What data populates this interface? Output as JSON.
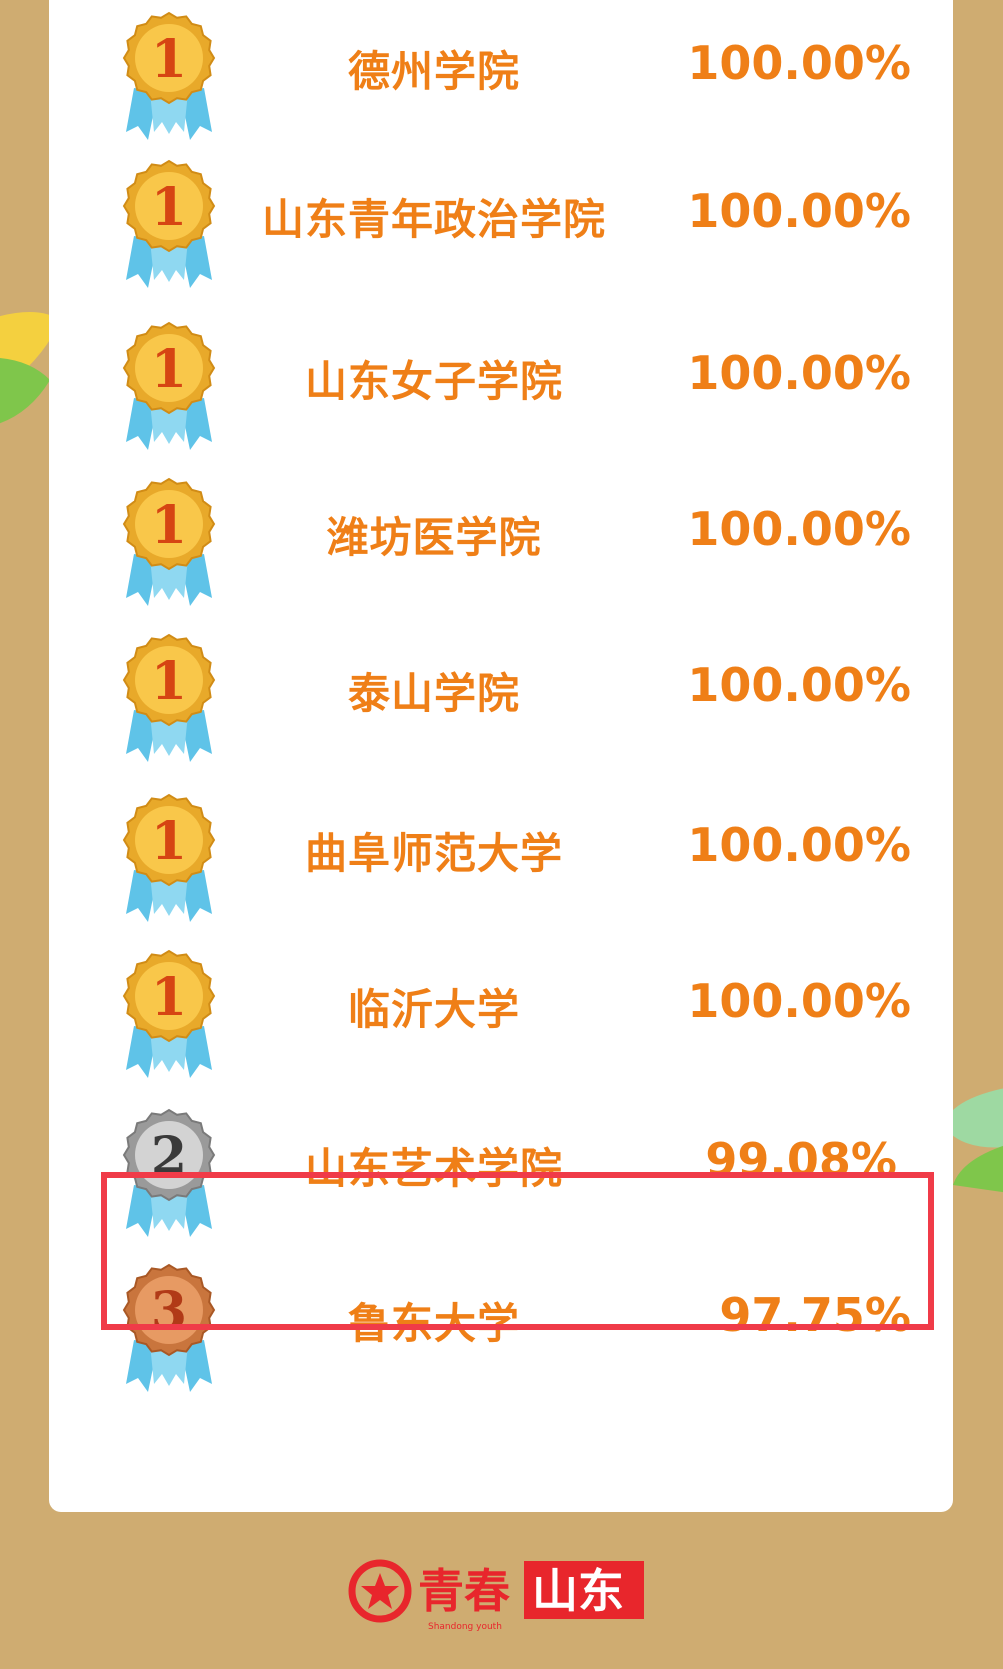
{
  "colors": {
    "background": "#cfac71",
    "text_accent": "#ef7f17",
    "highlight_border": "#f03b48",
    "logo_red": "#e8262c"
  },
  "rows": [
    {
      "rank": "1",
      "name": "德州学院",
      "percent": "100.00%",
      "medal": "gold"
    },
    {
      "rank": "1",
      "name": "山东青年政治学院",
      "percent": "100.00%",
      "medal": "gold"
    },
    {
      "rank": "1",
      "name": "山东女子学院",
      "percent": "100.00%",
      "medal": "gold"
    },
    {
      "rank": "1",
      "name": "潍坊医学院",
      "percent": "100.00%",
      "medal": "gold"
    },
    {
      "rank": "1",
      "name": "泰山学院",
      "percent": "100.00%",
      "medal": "gold"
    },
    {
      "rank": "1",
      "name": "曲阜师范大学",
      "percent": "100.00%",
      "medal": "gold"
    },
    {
      "rank": "1",
      "name": "临沂大学",
      "percent": "100.00%",
      "medal": "gold"
    },
    {
      "rank": "2",
      "name": "山东艺术学院",
      "percent": "99.08%",
      "medal": "silver"
    },
    {
      "rank": "3",
      "name": "鲁东大学",
      "percent": "97.75%",
      "medal": "bronze"
    }
  ],
  "footer": {
    "logo_text_1": "青春",
    "logo_text_2": "山东",
    "logo_subtitle": "Shandong youth",
    "logo_icon": "star-circle-icon"
  }
}
